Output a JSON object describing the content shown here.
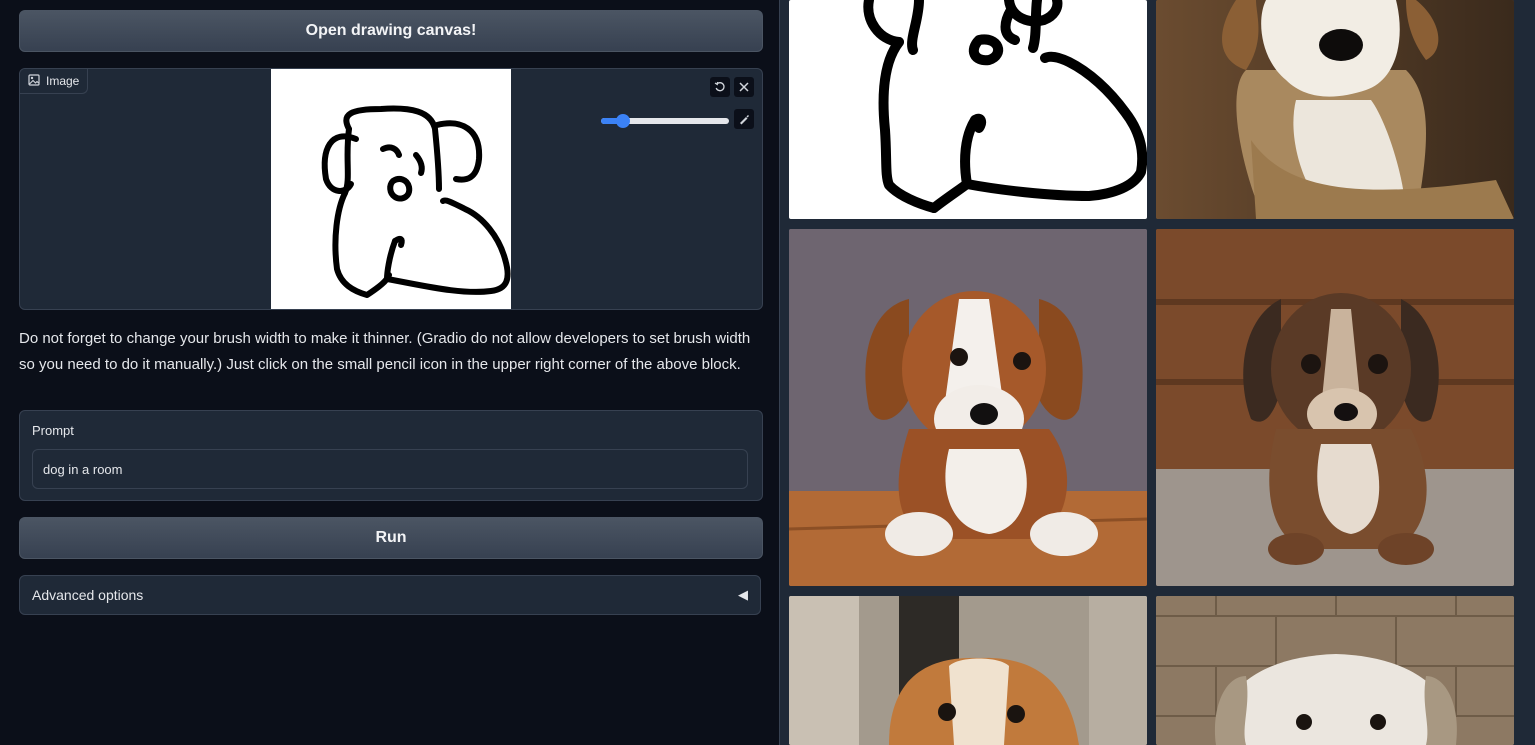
{
  "open_canvas_button": "Open drawing canvas!",
  "image_block": {
    "label": "Image",
    "brush_width_level": 0.17
  },
  "note": "Do not forget to change your brush width to make it thinner. (Gradio do not allow developers to set brush width so you need to do it manually.) Just click on the small pencil icon in the upper right corner of the above block.",
  "prompt": {
    "label": "Prompt",
    "value": "dog in a room"
  },
  "run_button": "Run",
  "advanced": {
    "label": "Advanced options",
    "arrow": "◀"
  },
  "icons": {
    "image": "image-icon",
    "undo": "undo-icon",
    "clear": "close-icon",
    "brush": "brush-icon"
  },
  "colors": {
    "background": "#0b0f19",
    "panel": "#1f2937",
    "accent": "#3b82f6"
  }
}
